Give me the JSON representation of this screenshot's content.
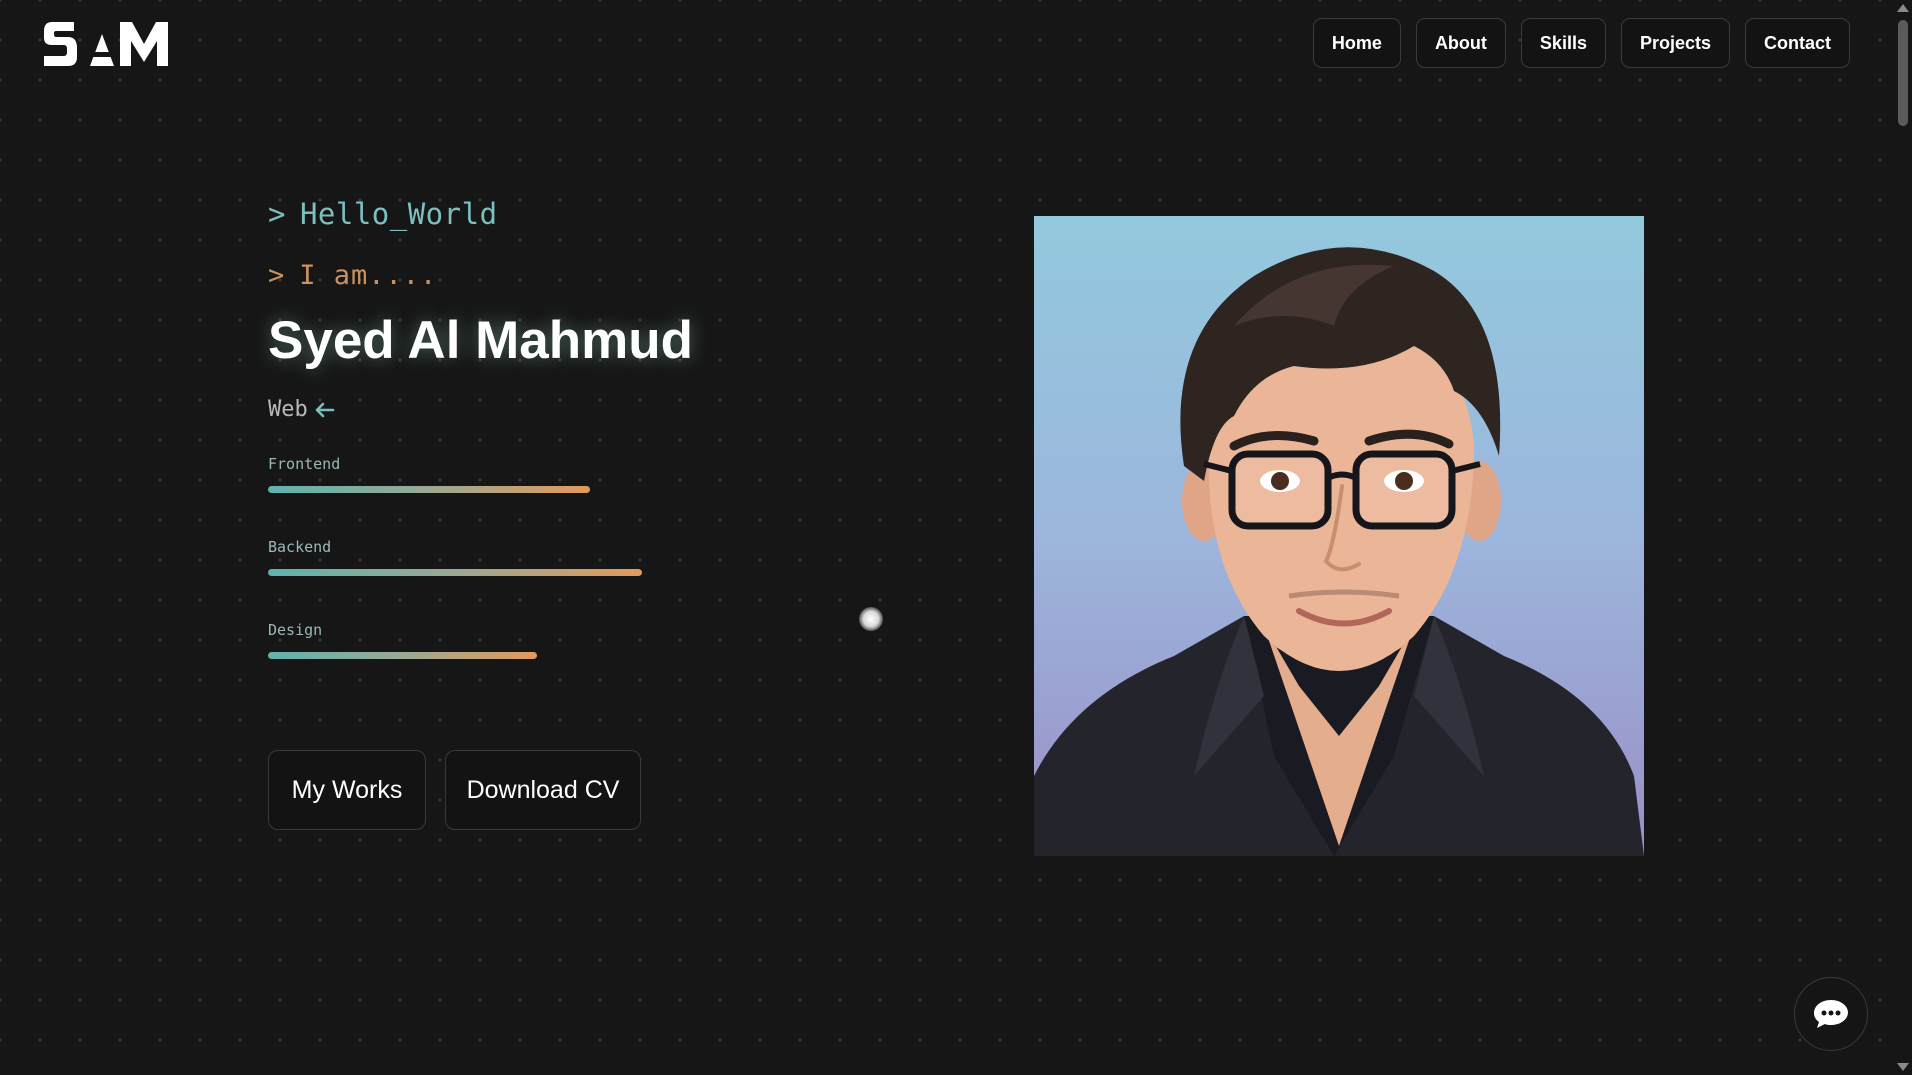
{
  "logo": {
    "text": "SAM"
  },
  "nav": {
    "items": [
      {
        "label": "Home"
      },
      {
        "label": "About"
      },
      {
        "label": "Skills"
      },
      {
        "label": "Projects"
      },
      {
        "label": "Contact"
      }
    ]
  },
  "hero": {
    "prompt_symbol": ">",
    "greeting": "Hello_World",
    "intro": "I am....",
    "name": "Syed Al Mahmud",
    "role": "Web",
    "role_icon": "arrow-left-icon",
    "skills": [
      {
        "label": "Frontend",
        "level": 0.67
      },
      {
        "label": "Backend",
        "level": 0.78
      },
      {
        "label": "Design",
        "level": 0.56
      }
    ],
    "buttons": {
      "works": "My Works",
      "cv": "Download CV"
    }
  },
  "portrait": {
    "icon": "portrait-illustration"
  },
  "chat": {
    "icon": "chat-bubble-icon"
  },
  "colors": {
    "background": "#161616",
    "teal": "#7dbfbf",
    "orange": "#c9925e",
    "bar_start": "#5fb3ad",
    "bar_end": "#e29a5c"
  }
}
